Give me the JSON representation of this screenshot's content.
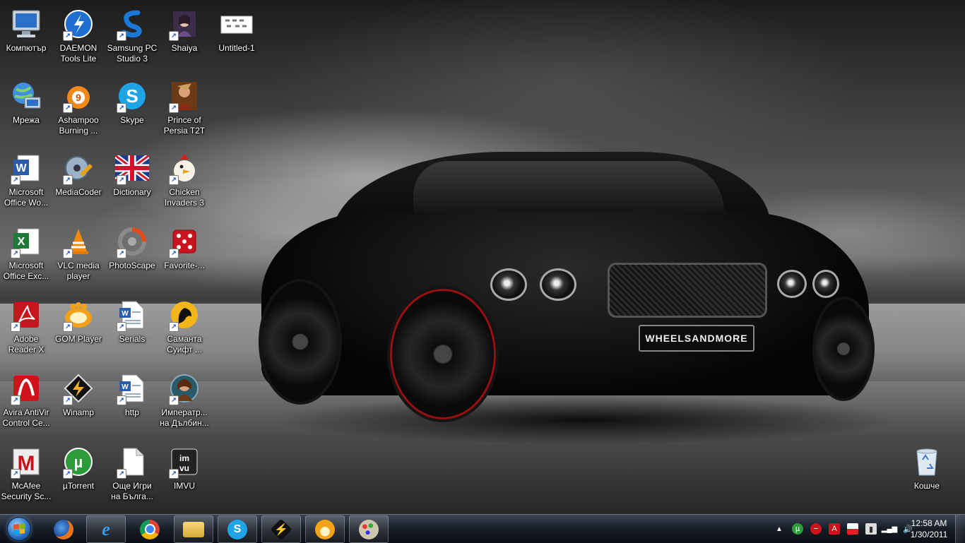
{
  "wallpaper": {
    "plate_text": "WHEELSANDMORE"
  },
  "desktop_icons": [
    {
      "label": "Компютър",
      "icon": "computer-icon"
    },
    {
      "label": "Мрежа",
      "icon": "network-icon"
    },
    {
      "label": "Microsoft\nOffice Wo...",
      "icon": "word-icon"
    },
    {
      "label": "Microsoft\nOffice Exc...",
      "icon": "excel-icon"
    },
    {
      "label": "Adobe\nReader X",
      "icon": "adobe-reader-icon"
    },
    {
      "label": "Avira AntiVir\nControl Ce...",
      "icon": "avira-icon"
    },
    {
      "label": "McAfee\nSecurity Sc...",
      "icon": "mcafee-icon"
    },
    {
      "label": "DAEMON\nTools Lite",
      "icon": "daemon-tools-icon"
    },
    {
      "label": "Ashampoo\nBurning ...",
      "icon": "ashampoo-icon"
    },
    {
      "label": "MediaCoder",
      "icon": "mediacoder-icon"
    },
    {
      "label": "VLC media\nplayer",
      "icon": "vlc-icon"
    },
    {
      "label": "GOM Player",
      "icon": "gom-player-icon"
    },
    {
      "label": "Winamp",
      "icon": "winamp-icon"
    },
    {
      "label": "µTorrent",
      "icon": "utorrent-icon"
    },
    {
      "label": "Samsung PC\nStudio 3",
      "icon": "samsung-pc-studio-icon"
    },
    {
      "label": "Skype",
      "icon": "skype-icon"
    },
    {
      "label": "Dictionary",
      "icon": "uk-flag-icon"
    },
    {
      "label": "PhotoScape",
      "icon": "photoscape-icon"
    },
    {
      "label": "Serials",
      "icon": "document-icon"
    },
    {
      "label": "http",
      "icon": "document-icon"
    },
    {
      "label": "Още Игри\nна Бълга...",
      "icon": "blank-file-icon"
    },
    {
      "label": "Shaiya",
      "icon": "shaiya-icon"
    },
    {
      "label": "Prince of\nPersia T2T",
      "icon": "prince-of-persia-icon"
    },
    {
      "label": "Chicken\nInvaders 3",
      "icon": "chicken-invaders-icon"
    },
    {
      "label": "Favorite-...",
      "icon": "dice-icon"
    },
    {
      "label": "Саманта\nСуифт ...",
      "icon": "samantha-swift-icon"
    },
    {
      "label": "Императр...\nна Дълбин...",
      "icon": "game-portrait-icon"
    },
    {
      "label": "IMVU",
      "icon": "imvu-icon"
    },
    {
      "label": "Untitled-1",
      "icon": "image-file-icon"
    },
    {
      "label": "Кошче",
      "icon": "recycle-bin-icon"
    }
  ],
  "taskbar": {
    "start_label": "Start",
    "buttons": [
      {
        "name": "firefox",
        "icon": "firefox-icon"
      },
      {
        "name": "internet-explorer",
        "icon": "ie-icon"
      },
      {
        "name": "chrome",
        "icon": "chrome-icon"
      },
      {
        "name": "windows-explorer",
        "icon": "folder-icon"
      },
      {
        "name": "skype",
        "icon": "skype-icon"
      },
      {
        "name": "winamp",
        "icon": "winamp-icon"
      },
      {
        "name": "gom-player",
        "icon": "gom-player-icon"
      },
      {
        "name": "paint",
        "icon": "paint-icon"
      }
    ],
    "tray_icons": [
      "show-hidden-icon",
      "utorrent-icon",
      "antivir-icon",
      "adobe-icon",
      "flag-icon",
      "safely-remove-icon",
      "network-signal-icon",
      "volume-icon"
    ],
    "clock": {
      "time": "12:58 AM",
      "date": "1/30/2011"
    }
  },
  "colors": {
    "taskbar": "#1a2230",
    "start_orb": "#2f74c8"
  }
}
